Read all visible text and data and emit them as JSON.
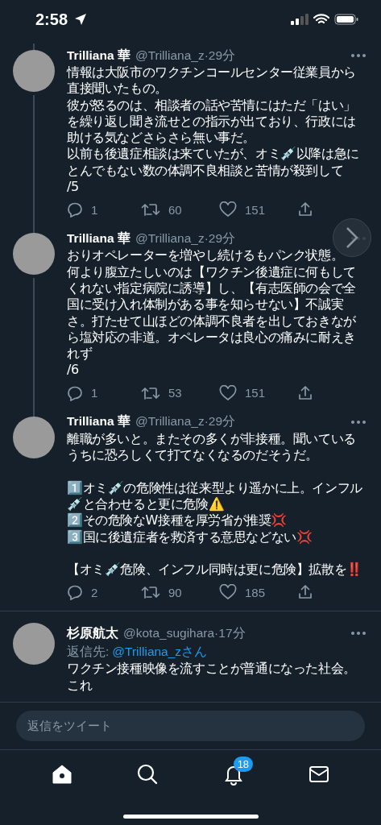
{
  "status_bar": {
    "time": "2:58"
  },
  "tweets": [
    {
      "name": "Trilliana 華",
      "meta": "@Trilliana_z·29分",
      "thread": true,
      "blocks": [
        [
          "情報は大阪市のワクチンコールセンター従業員から直接聞いたもの。",
          "彼が怒るのは、相談者の話や苦情にはただ「はい」を繰り返し聞き流せとの指示が出ており、行政には助ける気などさらさら無い事だ。",
          "以前も後遺症相談は来ていたが、オミ💉以降は急にとんでもない数の体調不良相談と苦情が殺到して",
          "/5"
        ]
      ],
      "counts": {
        "replies": "1",
        "retweets": "60",
        "likes": "151"
      }
    },
    {
      "name": "Trilliana 華",
      "meta": "@Trilliana_z·29分",
      "thread": true,
      "blocks": [
        [
          "おりオペレーターを増やし続けるもパンク状態。",
          "何より腹立たしいのは【ワクチン後遺症に何もしてくれない指定病院に誘導】し、【有志医師の会で全国に受け入れ体制がある事を知らせない】不誠実さ。打たせて山ほどの体調不良者を出しておきながら塩対応の非道。オペレータは良心の痛みに耐えきれず",
          "/6"
        ]
      ],
      "counts": {
        "replies": "1",
        "retweets": "53",
        "likes": "151"
      }
    },
    {
      "name": "Trilliana 華",
      "meta": "@Trilliana_z·29分",
      "thread": false,
      "blocks": [
        [
          "離職が多いと。またその多くが非接種。聞いているうちに恐ろしくて打てなくなるのだそうだ。"
        ],
        [
          "1️⃣オミ💉の危険性は従来型より遥かに上。インフル💉と合わせると更に危険⚠️",
          "2️⃣その危険なW接種を厚労省が推奨💢",
          "3️⃣国に後遺症者を救済する意思などない💢"
        ],
        [
          "【オミ💉危険、インフル同時は更に危険】拡散を‼️"
        ]
      ],
      "counts": {
        "replies": "2",
        "retweets": "90",
        "likes": "185"
      }
    },
    {
      "name": "杉原航太",
      "meta": "@kota_sugihara·17分",
      "thread": false,
      "reply_label": "返信先:",
      "reply_handle": "@Trilliana_zさん",
      "blocks": [
        [
          "ワクチン接種映像を流すことが普通になった社会。これ"
        ]
      ]
    }
  ],
  "reply_field": {
    "placeholder": "返信をツイート"
  },
  "nav": [
    {
      "kind": "home",
      "selected": true
    },
    {
      "kind": "search",
      "selected": false
    },
    {
      "kind": "notifications",
      "selected": false,
      "badge": "18"
    },
    {
      "kind": "messages",
      "selected": false
    }
  ]
}
